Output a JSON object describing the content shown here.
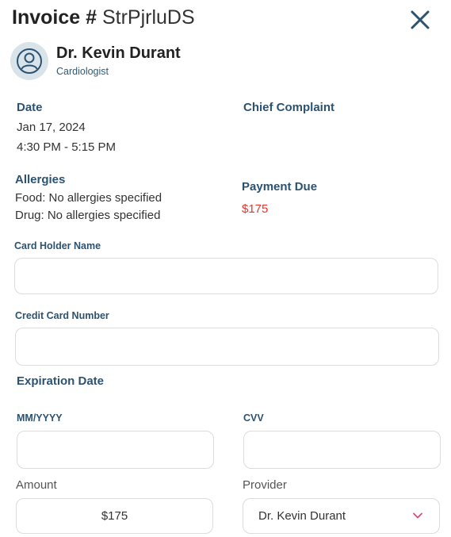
{
  "header": {
    "title_prefix": "Invoice #",
    "invoice_id": "StrPjrluDS",
    "close_icon": "close-icon"
  },
  "doctor": {
    "name": "Dr. Kevin Durant",
    "specialty": "Cardiologist",
    "avatar_icon": "user-avatar-icon"
  },
  "details": {
    "date_label": "Date",
    "date": "Jan 17, 2024",
    "time": "4:30 PM - 5:15 PM",
    "complaint_label": "Chief Complaint",
    "allergies_label": "Allergies",
    "food_allergies": "Food: No allergies specified",
    "drug_allergies": "Drug: No allergies specified",
    "payment_label": "Payment Due",
    "payment_amount": "$175"
  },
  "form": {
    "card_holder_label": "Card Holder Name",
    "card_holder_value": "",
    "card_number_label": "Credit Card Number",
    "card_number_value": "",
    "expiration_label": "Expiration Date",
    "mmyyyy_label": "MM/YYYY",
    "mmyyyy_value": "",
    "cvv_label": "CVV",
    "cvv_value": "",
    "amount_label": "Amount",
    "amount_value": "$175",
    "provider_label": "Provider",
    "provider_value": "Dr. Kevin Durant",
    "provider_icon": "chevron-down-icon"
  },
  "colors": {
    "heading": "#2c5271",
    "accent_red": "#e8332a",
    "chevron": "#d94a78",
    "close": "#2c5271"
  }
}
